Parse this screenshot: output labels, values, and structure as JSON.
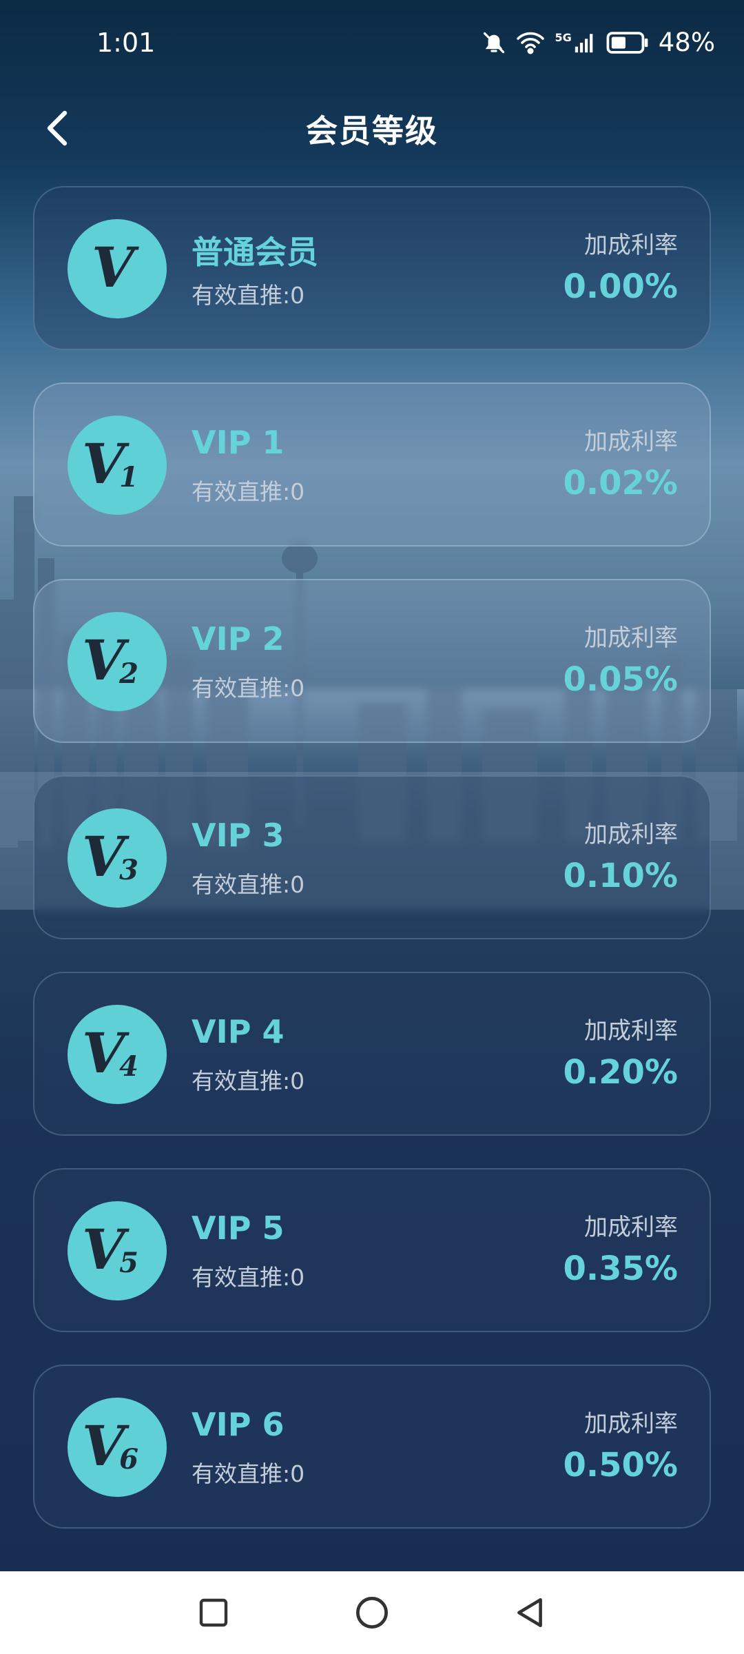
{
  "status_bar": {
    "time": "1:01",
    "network": "5G",
    "battery": "48%",
    "battery_level": 0.48
  },
  "header": {
    "title": "会员等级"
  },
  "levels": [
    {
      "badge_sub": "",
      "name": "普通会员",
      "referrals": "有效直推:0",
      "rate_label": "加成利率",
      "rate": "0.00%"
    },
    {
      "badge_sub": "1",
      "name": "VIP 1",
      "referrals": "有效直推:0",
      "rate_label": "加成利率",
      "rate": "0.02%"
    },
    {
      "badge_sub": "2",
      "name": "VIP 2",
      "referrals": "有效直推:0",
      "rate_label": "加成利率",
      "rate": "0.05%"
    },
    {
      "badge_sub": "3",
      "name": "VIP 3",
      "referrals": "有效直推:0",
      "rate_label": "加成利率",
      "rate": "0.10%"
    },
    {
      "badge_sub": "4",
      "name": "VIP 4",
      "referrals": "有效直推:0",
      "rate_label": "加成利率",
      "rate": "0.20%"
    },
    {
      "badge_sub": "5",
      "name": "VIP 5",
      "referrals": "有效直推:0",
      "rate_label": "加成利率",
      "rate": "0.35%"
    },
    {
      "badge_sub": "6",
      "name": "VIP 6",
      "referrals": "有效直推:0",
      "rate_label": "加成利率",
      "rate": "0.50%"
    }
  ],
  "badge_letter": "V",
  "nav": {
    "recents_icon": "square-icon",
    "home_icon": "circle-icon",
    "back_icon": "triangle-back-icon"
  },
  "colors": {
    "accent": "#66d3da",
    "badge": "#5fd0d6"
  }
}
